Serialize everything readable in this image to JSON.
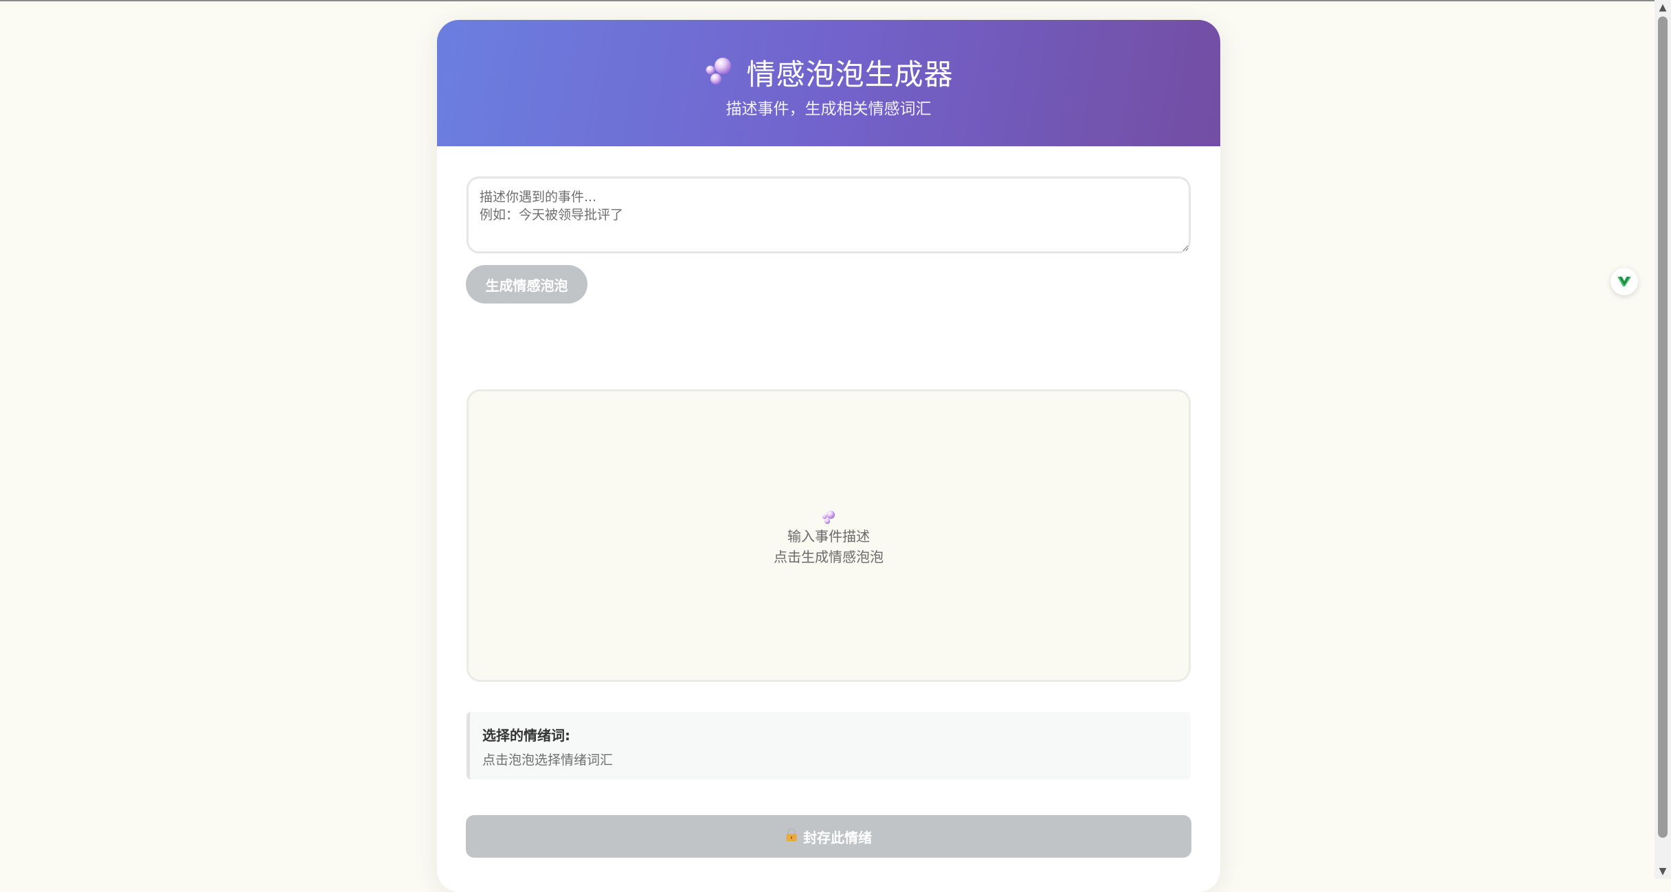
{
  "header": {
    "title": "情感泡泡生成器",
    "subtitle": "描述事件，生成相关情感词汇",
    "gradient_start": "#6b7fe0",
    "gradient_end": "#734ea3"
  },
  "input": {
    "value": "",
    "placeholder": "描述你遇到的事件...\n例如：今天被领导批评了"
  },
  "generate_button": {
    "label": "生成情感泡泡",
    "color": "#c1c4c7"
  },
  "bubble_area": {
    "empty_line1": "输入事件描述",
    "empty_line2": "点击生成情感泡泡"
  },
  "selected": {
    "title": "选择的情绪词:",
    "hint": "点击泡泡选择情绪词汇"
  },
  "seal_button": {
    "label": "封存此情绪",
    "icon": "lock-icon"
  },
  "icons": {
    "title_icon": "bubbles-icon",
    "extension_icon": "extension-badge-icon"
  }
}
